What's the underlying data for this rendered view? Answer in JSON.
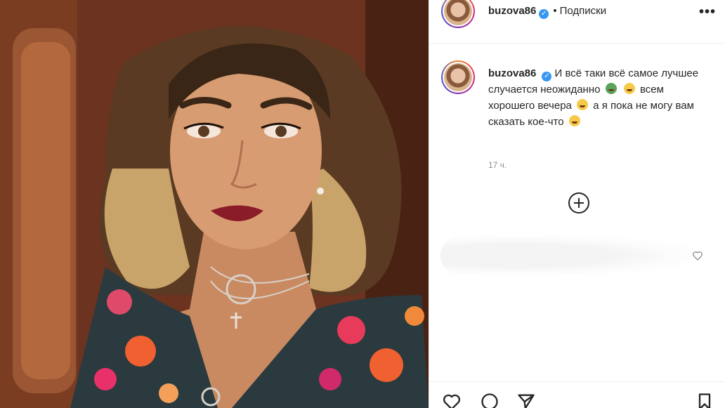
{
  "post": {
    "username": "buzova86",
    "verified_mark": "✓",
    "separator": "•",
    "follow_status": "Подписки",
    "more_label": "•••",
    "caption_line1": "И всё таки всё самое лучшее случается неожиданно",
    "caption_line2": "всем хорошего вечера",
    "caption_line3": "а я пока не могу вам сказать кое-что",
    "timestamp": "17 ч."
  },
  "icons": {
    "more": "more-options-icon",
    "add_comments": "plus-circle-icon",
    "like_comment": "heart-icon",
    "like_post": "heart-icon",
    "comment": "comment-icon",
    "share": "send-icon",
    "save": "bookmark-icon"
  },
  "colors": {
    "verified": "#3897f0",
    "text": "#262626",
    "muted": "#8e8e8e",
    "border": "#efefef"
  }
}
